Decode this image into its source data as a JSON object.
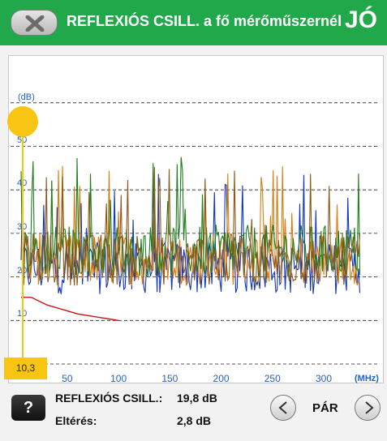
{
  "header": {
    "title": "REFLEXIÓS CSILL. a fő mérőműszernél",
    "status": "JÓ",
    "back_icon": "close-x-icon",
    "color": "#21a84a"
  },
  "chart_data": {
    "type": "line",
    "yunit": "(dB)",
    "xunit": "(MHz)",
    "ylim": [
      0,
      60
    ],
    "xlim": [
      5,
      300
    ],
    "yticks": [
      "10",
      "20",
      "30",
      "40",
      "50"
    ],
    "xticks": [
      "50",
      "100",
      "150",
      "200",
      "250",
      "300"
    ],
    "grid": true,
    "series": [
      {
        "color": "#1034c0",
        "approx_level_db": 22
      },
      {
        "color": "#d97c10",
        "approx_level_db": 24
      },
      {
        "color": "#1e7d1e",
        "approx_level_db": 26
      },
      {
        "color": "#8b5a1a",
        "approx_level_db": 24
      }
    ],
    "limit_line": {
      "color": "#cc1111",
      "x": [
        5,
        15,
        30,
        60,
        100
      ],
      "y": [
        15.3,
        15.3,
        13.6,
        11.5,
        10.0
      ]
    }
  },
  "marker": {
    "value": "10,3",
    "color": "#f8c513"
  },
  "results": {
    "reflection_label": "REFLEXIÓS CSILL.:",
    "reflection_value": "19,8 dB",
    "deviation_label": "Eltérés:",
    "deviation_value": "2,8 dB"
  },
  "help": {
    "label": "?"
  },
  "nav": {
    "label": "PÁR",
    "prev_icon": "chevron-left-icon",
    "next_icon": "chevron-right-icon"
  }
}
